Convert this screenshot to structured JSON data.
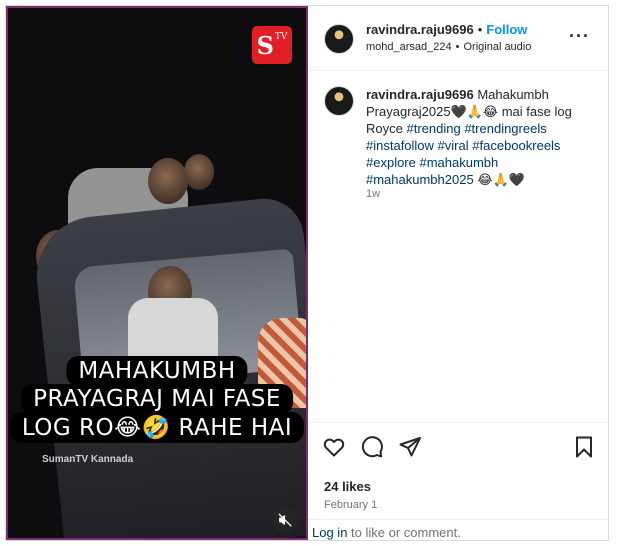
{
  "video": {
    "logo_text": "S",
    "logo_small": "TV",
    "caption_lines": [
      "MAHAKUMBH",
      "PRAYAGRAJ MAI FASE",
      "LOG RO😂🤣 RAHE HAI"
    ],
    "watermark": "SumanTV Kannada",
    "mute_icon": "speaker-muted-icon"
  },
  "header": {
    "username": "ravindra.raju9696",
    "separator": "•",
    "follow_label": "Follow",
    "audio_user": "mohd_arsad_224",
    "audio_separator": "•",
    "audio_label": "Original audio",
    "more_label": "···"
  },
  "comment": {
    "username": "ravindra.raju9696",
    "text": "Mahakumbh Prayagraj2025🖤🙏😂 mai fase log Royce",
    "hashtags": [
      "#trending",
      "#trendingreels",
      "#instafollow",
      "#viral",
      "#facebookreels",
      "#explore",
      "#mahakumbh",
      "#mahakumbh2025"
    ],
    "trailing_emoji": "😂🙏🖤",
    "age": "1w"
  },
  "actions": {
    "icons": [
      "heart-icon",
      "comment-icon",
      "share-icon",
      "bookmark-icon"
    ],
    "likes": "24 likes",
    "date": "February 1",
    "login_link": "Log in",
    "login_suffix": "to like or comment."
  },
  "colors": {
    "accent": "#0095f6",
    "video_border": "#7d2d6e",
    "hashtag": "#00376b",
    "muted_text": "#737373"
  }
}
